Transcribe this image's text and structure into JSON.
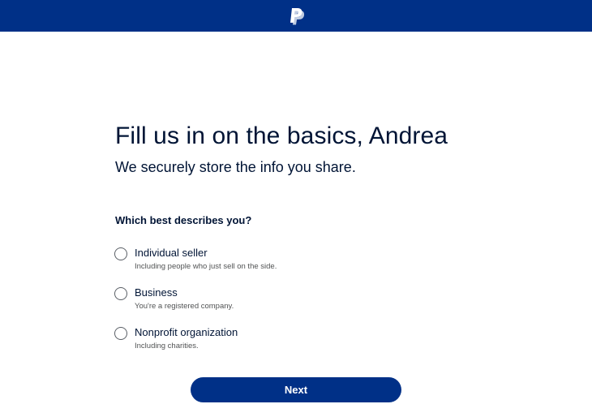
{
  "header": {
    "logo_icon": "paypal-logo-icon",
    "background_color": "#003087"
  },
  "main": {
    "title": "Fill us in on the basics, Andrea",
    "subtitle": "We securely store the info you share."
  },
  "question": {
    "label": "Which best describes you?",
    "options": [
      {
        "label": "Individual seller",
        "description": "Including people who just sell on the side.",
        "selected": false
      },
      {
        "label": "Business",
        "description": "You're a registered company.",
        "selected": false
      },
      {
        "label": "Nonprofit organization",
        "description": "Including charities.",
        "selected": false
      }
    ]
  },
  "footer": {
    "next_label": "Next",
    "button_color": "#003087"
  }
}
